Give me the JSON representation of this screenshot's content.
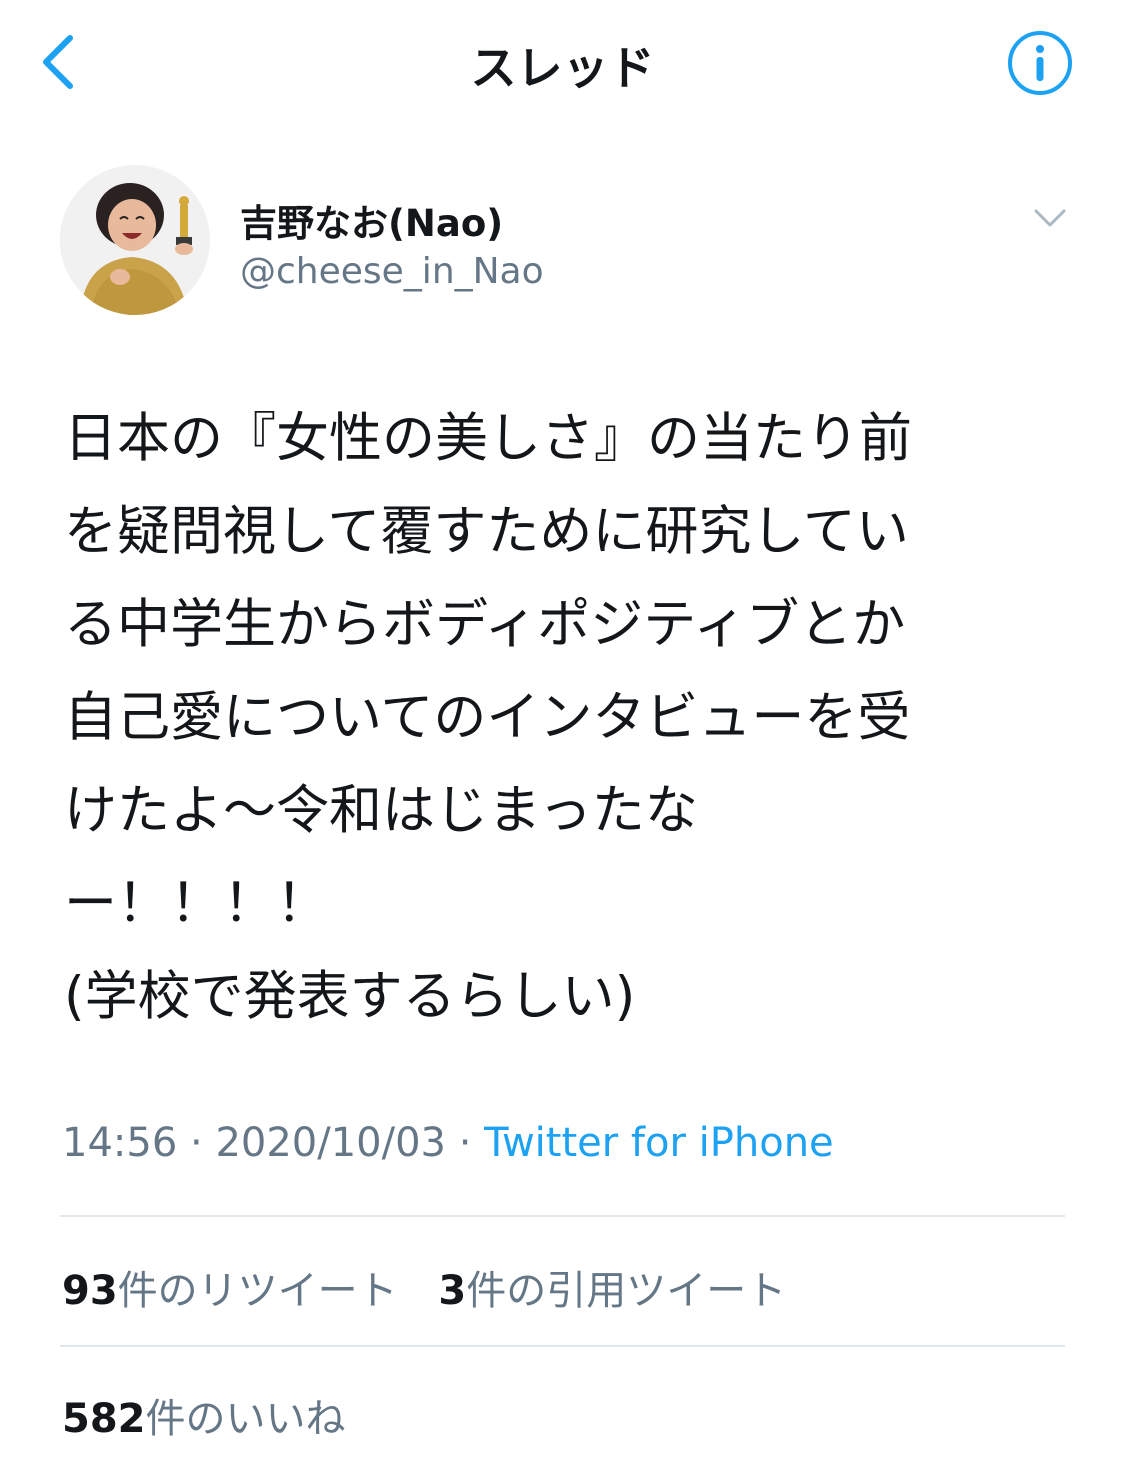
{
  "nav": {
    "title": "スレッド",
    "back_icon": "chevron-left-icon",
    "info_icon": "info-circle-icon"
  },
  "author": {
    "display_name": "吉野なお(Nao)",
    "handle": "@cheese_in_Nao",
    "more_icon": "chevron-down-icon"
  },
  "tweet": {
    "lines": [
      "日本の『女性の美しさ』の当たり前",
      "を疑問視して覆すために研究してい",
      "る中学生からボディポジティブとか",
      "自己愛についてのインタビューを受",
      "けたよ〜令和はじまったな",
      "ー！！！！",
      "(学校で発表するらしい)"
    ],
    "time": "14:56",
    "separator": " · ",
    "date": "2020/10/03",
    "source": "Twitter for iPhone"
  },
  "stats": {
    "retweets_count": "93",
    "retweets_label": "件のリツイート",
    "quotes_count": "3",
    "quotes_label": "件の引用ツイート",
    "likes_count": "582",
    "likes_label": "件のいいね"
  },
  "colors": {
    "accent": "#1da1f2",
    "secondary_text": "#657786",
    "primary_text": "#14171a",
    "divider": "#e1e8ed"
  }
}
